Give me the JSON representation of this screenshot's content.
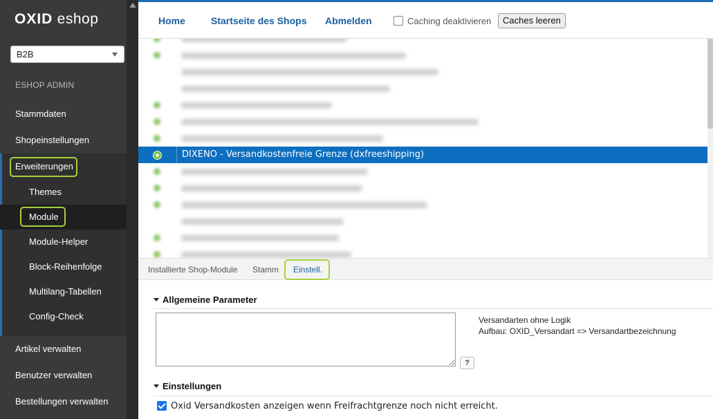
{
  "brand": {
    "logo_bold": "OXID",
    "logo_rest": " eshop"
  },
  "shop_selector": {
    "value": "B2B"
  },
  "sidebar": {
    "section_label": "ESHOP ADMIN",
    "items": [
      {
        "label": "Stammdaten"
      },
      {
        "label": "Shopeinstellungen"
      },
      {
        "label": "Erweiterungen"
      },
      {
        "label": "Artikel verwalten"
      },
      {
        "label": "Benutzer verwalten"
      },
      {
        "label": "Bestellungen verwalten"
      }
    ],
    "sub_items": [
      {
        "label": "Themes"
      },
      {
        "label": "Module"
      },
      {
        "label": "Module-Helper"
      },
      {
        "label": "Block-Reihenfolge"
      },
      {
        "label": "Multilang-Tabellen"
      },
      {
        "label": "Config-Check"
      }
    ]
  },
  "topbar": {
    "home": "Home",
    "shop_start": "Startseite des Shops",
    "logout": "Abmelden",
    "caching_label": "Caching deaktivieren",
    "clear_caches": "Caches leeren"
  },
  "module_list": {
    "selected_title": "DIXENO - Versandkostenfreie Grenze (dxfreeshipping)"
  },
  "tabs": [
    {
      "label": "Installierte Shop-Module"
    },
    {
      "label": "Stamm"
    },
    {
      "label": "Einstell."
    }
  ],
  "settings": {
    "general_heading": "Allgemeine Parameter",
    "textarea_value": "",
    "help_line1": "Versandarten ohne Logik",
    "help_line2": "Aufbau: OXID_Versandart => Versandartbezeichnung",
    "help_button": "?",
    "settings_heading": "Einstellungen",
    "checkbox_label": "Oxid Versandkosten anzeigen wenn Freifrachtgrenze noch nicht erreicht.",
    "checkbox_checked": true
  },
  "colors": {
    "accent": "#1b6bb0",
    "highlight": "#a6d13a",
    "selected_row": "#0d6ebf"
  }
}
